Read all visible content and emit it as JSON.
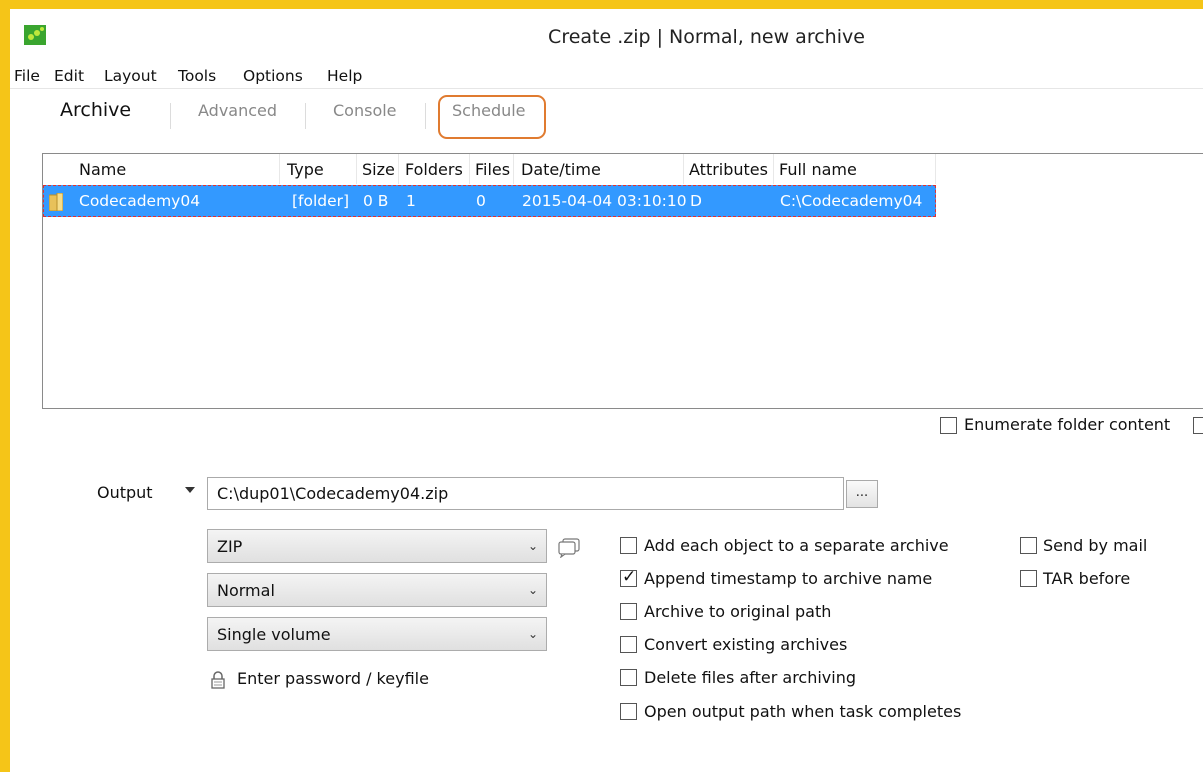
{
  "window": {
    "title": "Create .zip | Normal, new archive"
  },
  "menu": [
    "File",
    "Edit",
    "Layout",
    "Tools",
    "Options",
    "Help"
  ],
  "tabs": {
    "archive": "Archive",
    "advanced": "Advanced",
    "console": "Console",
    "schedule": "Schedule"
  },
  "filelist": {
    "columns": [
      "Name",
      "Type",
      "Size",
      "Folders",
      "Files",
      "Date/time",
      "Attributes",
      "Full name"
    ],
    "rows": [
      {
        "name": "Codecademy04",
        "type": "[folder]",
        "size": "0 B",
        "folders": "1",
        "files": "0",
        "datetime": "2015-04-04 03:10:10",
        "attributes": "D",
        "fullname": "C:\\Codecademy04"
      }
    ],
    "selected_color": "#3399ff"
  },
  "enumerate": {
    "label": "Enumerate folder content",
    "checked": false
  },
  "output": {
    "label": "Output",
    "path": "C:\\dup01\\Codecademy04.zip",
    "browse_label": "..."
  },
  "selects": {
    "format": "ZIP",
    "compression": "Normal",
    "volume": "Single volume"
  },
  "password": {
    "label": "Enter password / keyfile"
  },
  "options": [
    {
      "label": "Add each object to a separate archive",
      "checked": false
    },
    {
      "label": "Append timestamp to archive name",
      "checked": true
    },
    {
      "label": "Archive to original path",
      "checked": false
    },
    {
      "label": "Convert existing archives",
      "checked": false
    },
    {
      "label": "Delete files after archiving",
      "checked": false
    },
    {
      "label": "Open output path when task completes",
      "checked": false
    }
  ],
  "options_right": [
    {
      "label": "Send by mail",
      "checked": false
    },
    {
      "label": "TAR before",
      "checked": false
    }
  ],
  "colors": {
    "frame": "#f5c518",
    "highlight": "#e07b30"
  }
}
